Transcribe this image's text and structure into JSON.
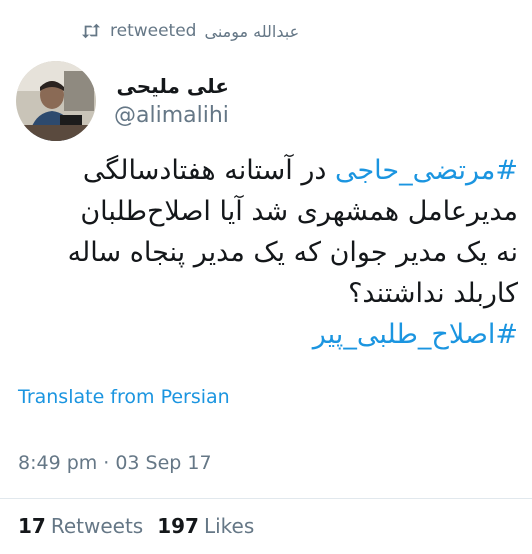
{
  "retweet": {
    "icon": "retweet-icon",
    "label": "retweeted",
    "retweeter_name": "عبدالله مومنی"
  },
  "author": {
    "name": "علی ملیحی",
    "handle": "@alimalihi"
  },
  "tweet": {
    "hashtag_1": "#مرتضی_حاجی",
    "line_1_text": " در آستانه هفتادسالگی",
    "line_2": "مدیرعامل همشهری شد آیا اصلاح‌طلبان",
    "line_3": "نه یک مدیر جوان که یک مدیر پنجاه ساله",
    "line_4": "کاربلد نداشتند؟",
    "hashtag_2": "#اصلاح_طلبی_پیر"
  },
  "translate_label": "Translate from Persian",
  "meta": {
    "time": "8:49 pm",
    "separator": "·",
    "date": "03 Sep 17"
  },
  "stats": {
    "retweets_count": "17",
    "retweets_label": "Retweets",
    "likes_count": "197",
    "likes_label": "Likes"
  },
  "colors": {
    "link": "#1b95e0",
    "secondary_text": "#657786",
    "primary_text": "#14171a",
    "divider": "#e1e8ed"
  }
}
